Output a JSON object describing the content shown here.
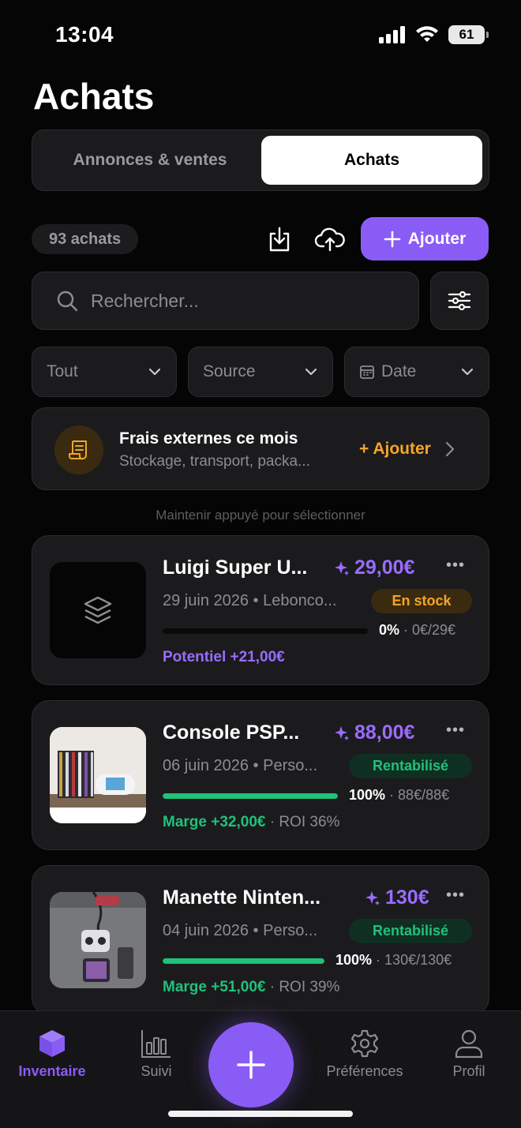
{
  "status": {
    "time": "13:04",
    "battery": "61"
  },
  "header": {
    "title": "Achats"
  },
  "segmented": {
    "left": "Annonces & ventes",
    "right": "Achats"
  },
  "toolbar": {
    "count": "93 achats",
    "add_label": "Ajouter"
  },
  "search": {
    "placeholder": "Rechercher..."
  },
  "filters": {
    "all": "Tout",
    "source": "Source",
    "date": "Date"
  },
  "fees": {
    "title": "Frais externes ce mois",
    "subtitle": "Stockage, transport, packa...",
    "add_label": "+ Ajouter"
  },
  "hint": "Maintenir appuyé pour sélectionner",
  "items": [
    {
      "title": "Luigi Super U...",
      "price": "29,00€",
      "meta": "29 juin 2026 • Lebonco...",
      "status": "En stock",
      "progress": 0,
      "percent": "0%",
      "progress_detail": " · 0€/29€",
      "foot_main": "Potentiel +21,00€",
      "foot_extra": ""
    },
    {
      "title": "Console PSP...",
      "price": "88,00€",
      "meta": "06 juin 2026 • Perso...",
      "status": "Rentabilisé",
      "progress": 100,
      "percent": "100%",
      "progress_detail": " · 88€/88€",
      "foot_main": "Marge +32,00€",
      "foot_extra": " · ROI 36%"
    },
    {
      "title": "Manette Ninten...",
      "price": "130€",
      "meta": "04 juin 2026 • Perso...",
      "status": "Rentabilisé",
      "progress": 100,
      "percent": "100%",
      "progress_detail": " · 130€/130€",
      "foot_main": "Marge +51,00€",
      "foot_extra": " · ROI 39%"
    }
  ],
  "tabs": {
    "inventory": "Inventaire",
    "tracking": "Suivi",
    "preferences": "Préférences",
    "profile": "Profil"
  },
  "colors": {
    "accent": "#8a5cf6",
    "success": "#20c17a",
    "warning": "#f5a524",
    "background": "#050505"
  }
}
